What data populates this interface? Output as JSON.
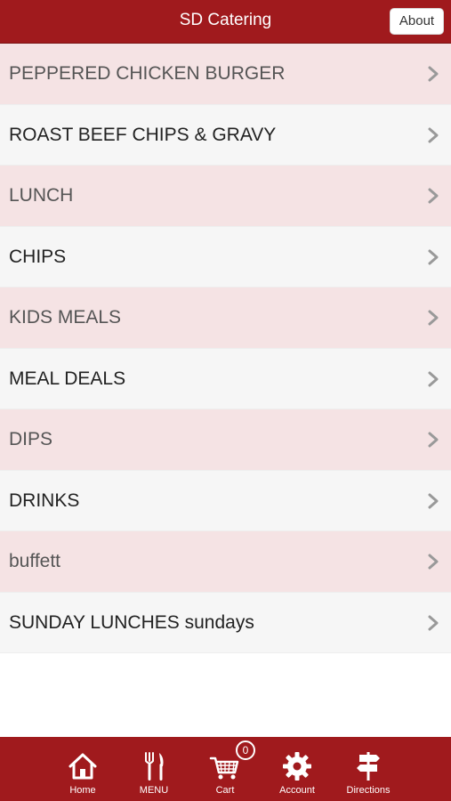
{
  "header": {
    "title": "SD Catering",
    "about_label": "About"
  },
  "menu": {
    "items": [
      {
        "label": "PEPPERED CHICKEN BURGER"
      },
      {
        "label": "ROAST BEEF CHIPS & GRAVY"
      },
      {
        "label": "LUNCH"
      },
      {
        "label": "CHIPS"
      },
      {
        "label": "KIDS MEALS"
      },
      {
        "label": "MEAL DEALS"
      },
      {
        "label": "DIPS"
      },
      {
        "label": "DRINKS"
      },
      {
        "label": "buffett"
      },
      {
        "label": "SUNDAY LUNCHES sundays"
      }
    ]
  },
  "footer": {
    "home_label": "Home",
    "menu_label": "MENU",
    "cart_label": "Cart",
    "cart_count": "0",
    "account_label": "Account",
    "directions_label": "Directions"
  },
  "colors": {
    "brand": "#a01a1d",
    "row_tinted": "#f5e3e4",
    "row_plain": "#f6f6f6"
  },
  "icons": [
    "home-icon",
    "fork-knife-icon",
    "cart-icon",
    "gear-icon",
    "signpost-icon",
    "chevron-right-icon"
  ]
}
